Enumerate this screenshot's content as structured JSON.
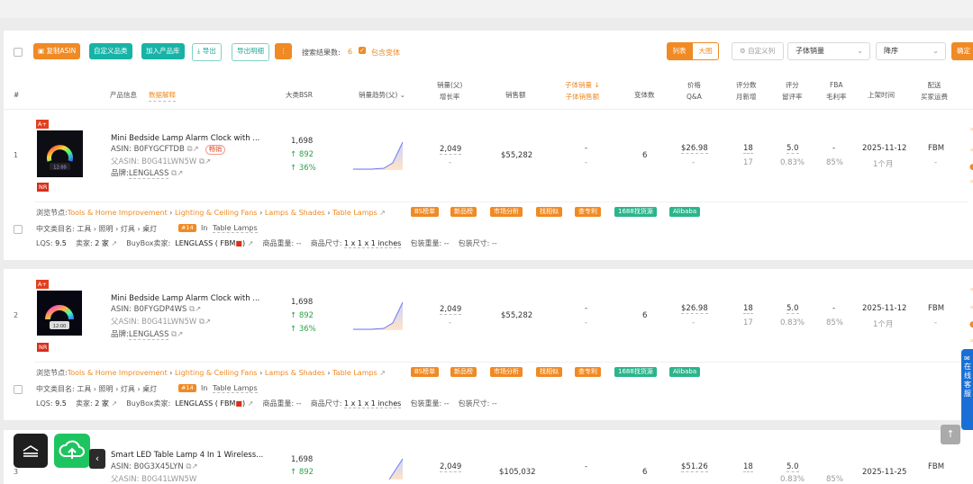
{
  "toolbar": {
    "copy_asin": "复制ASIN",
    "custom_product": "自定义品类",
    "add_library": "加入产品库",
    "export": "导出",
    "export_detail": "导出明细",
    "more": "⋮",
    "result_label": "搜索结果数:",
    "result_count": "6",
    "include_variants": "包含变体",
    "view_list": "列表",
    "view_grid": "大图",
    "custom_cols": "自定义列",
    "sort_field": "子体销量",
    "sort_order": "降序",
    "confirm": "确定"
  },
  "headers": {
    "index": "#",
    "product_info": "产品信息",
    "data_explain": "数据解释",
    "bsr": "大类BSR",
    "trend": "销量趋势(父)",
    "sales_parent": "销量(父)",
    "growth": "增长率",
    "revenue": "销售额",
    "child_sales": "子体销量",
    "child_revenue": "子体销售额",
    "variants": "变体数",
    "price": "价格",
    "qa": "Q&A",
    "reviews": "评分数",
    "monthly_new": "月新增",
    "rating": "评分",
    "retention": "留评率",
    "fba": "FBA",
    "margin": "毛利率",
    "launch": "上架时间",
    "delivery": "配送",
    "buyer_ship": "买家运费"
  },
  "rows": [
    {
      "index": "1",
      "title": "Mini Bedside Lamp Alarm Clock with ...",
      "asin_label": "ASIN:",
      "asin": "B0FYGCFTDB",
      "hot": "畅销",
      "parent_label": "父ASIN:",
      "parent_asin": "B0G41LWN5W",
      "brand_label": "品牌:",
      "brand": "LENGLASS",
      "bsr": "1,698",
      "bsr_change": "↑ 892",
      "bsr_pct": "↑ 36%",
      "sales": "2,049",
      "growth": "-",
      "revenue": "$55,282",
      "child_sales": "-",
      "child_revenue": "-",
      "variants": "6",
      "price": "$26.98",
      "qa": "-",
      "reviews": "18",
      "monthly_new": "17",
      "rating": "5.0",
      "retention": "0.83%",
      "fba": "-",
      "margin": "85%",
      "launch": "2025-11-12",
      "age": "1个月",
      "delivery": "FBM",
      "ship_fee": "-",
      "browse_label": "浏览节点:",
      "browse": [
        "Tools & Home Improvement",
        "Lighting & Ceiling Fans",
        "Lamps & Shades",
        "Table Lamps"
      ],
      "cn_label": "中文类目名:",
      "cn_path": "工具 › 照明 › 灯具 › 桌灯",
      "rank_badge": "#14",
      "rank_in": "In",
      "rank_cat": "Table Lamps",
      "lqs_label": "LQS:",
      "lqs": "9.5",
      "sellers_label": "卖家:",
      "sellers": "2 家",
      "buybox_label": "BuyBox卖家:",
      "buybox": "LENGLASS ( FBM",
      "weight_label": "商品重量:",
      "weight": "--",
      "size_label": "商品尺寸:",
      "size": "1 x 1 x 1 inches",
      "pkg_weight_label": "包装重量:",
      "pkg_weight": "--",
      "pkg_size_label": "包装尺寸:",
      "pkg_size": "--"
    },
    {
      "index": "2",
      "title": "Mini Bedside Lamp Alarm Clock with ...",
      "asin_label": "ASIN:",
      "asin": "B0FYGDP4WS",
      "parent_label": "父ASIN:",
      "parent_asin": "B0G41LWN5W",
      "brand_label": "品牌:",
      "brand": "LENGLASS",
      "bsr": "1,698",
      "bsr_change": "↑ 892",
      "bsr_pct": "↑ 36%",
      "sales": "2,049",
      "growth": "-",
      "revenue": "$55,282",
      "child_sales": "-",
      "child_revenue": "-",
      "variants": "6",
      "price": "$26.98",
      "qa": "-",
      "reviews": "18",
      "monthly_new": "17",
      "rating": "5.0",
      "retention": "0.83%",
      "fba": "-",
      "margin": "85%",
      "launch": "2025-11-12",
      "age": "1个月",
      "delivery": "FBM",
      "ship_fee": "-",
      "browse_label": "浏览节点:",
      "browse": [
        "Tools & Home Improvement",
        "Lighting & Ceiling Fans",
        "Lamps & Shades",
        "Table Lamps"
      ],
      "cn_label": "中文类目名:",
      "cn_path": "工具 › 照明 › 灯具 › 桌灯",
      "rank_badge": "#14",
      "rank_in": "In",
      "rank_cat": "Table Lamps",
      "lqs_label": "LQS:",
      "lqs": "9.5",
      "sellers_label": "卖家:",
      "sellers": "2 家",
      "buybox_label": "BuyBox卖家:",
      "buybox": "LENGLASS ( FBM",
      "weight_label": "商品重量:",
      "weight": "--",
      "size_label": "商品尺寸:",
      "size": "1 x 1 x 1 inches",
      "pkg_weight_label": "包装重量:",
      "pkg_weight": "--",
      "pkg_size_label": "包装尺寸:",
      "pkg_size": "--"
    },
    {
      "index": "3",
      "title": "Smart LED Table Lamp 4 In 1 Wireless...",
      "asin_label": "ASIN:",
      "asin": "B0G3X45LYN",
      "parent_label": "父ASIN:",
      "parent_asin": "B0G41LWN5W",
      "bsr": "1,698",
      "bsr_change": "↑ 892",
      "sales": "2,049",
      "revenue": "$105,032",
      "child_sales": "-",
      "variants": "6",
      "price": "$51.26",
      "reviews": "18",
      "rating": "5.0",
      "retention": "0.83%",
      "margin": "85%",
      "launch": "2025-11-25",
      "delivery": "FBM"
    }
  ],
  "tags": [
    "BS榜单",
    "新品榜",
    "市场分析",
    "找相似",
    "查专利",
    "1688找货源",
    "Alibaba"
  ],
  "overlay": {
    "side_text": "在线客服",
    "back_top": "↑",
    "collapse": "‹"
  },
  "colors": {
    "accent": "#f08a24",
    "teal": "#17b3a6",
    "green": "#2ba34a",
    "blue_panel": "#1a6fd6"
  }
}
